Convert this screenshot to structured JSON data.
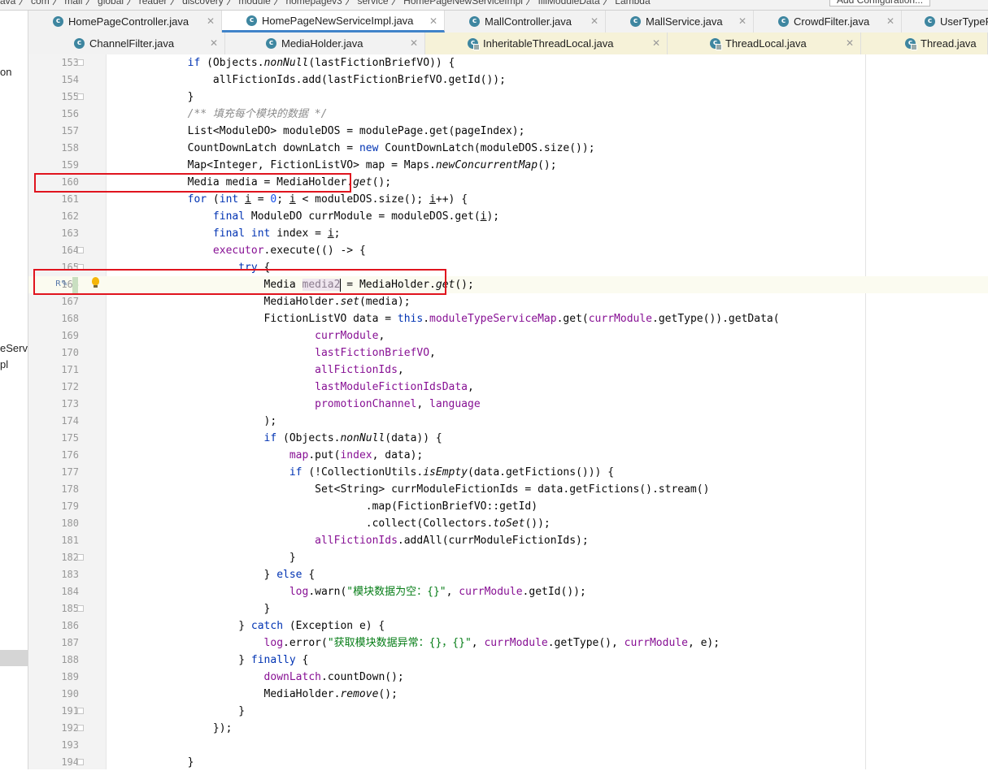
{
  "breadcrumb": {
    "path_text": "ava 〉 com 〉 mall 〉 global 〉 reader 〉 discovery 〉 module 〉 homepagev3 〉 service 〉 HomePageNewServiceImpl 〉 fillModuleData 〉 Lambda",
    "run_config": "Add Configuration..."
  },
  "left_panel": {
    "items": [
      "on",
      "eServi",
      "pl"
    ]
  },
  "tabs_row1": [
    {
      "label": "HomePageController.java"
    },
    {
      "label": "HomePageNewServiceImpl.java"
    },
    {
      "label": "MallController.java"
    },
    {
      "label": "MallService.java"
    },
    {
      "label": "CrowdFilter.java"
    },
    {
      "label": "UserTypeF"
    }
  ],
  "tabs_row2": [
    {
      "label": "ChannelFilter.java"
    },
    {
      "label": "MediaHolder.java"
    },
    {
      "label": "InheritableThreadLocal.java"
    },
    {
      "label": "ThreadLocal.java"
    },
    {
      "label": "Thread.java"
    }
  ],
  "editor": {
    "current_line": 166,
    "lines": [
      {
        "n": 153,
        "html": "        <span class=\"kw\">if</span> (Objects.<span class=\"it\">nonNull</span>(lastFictionBriefVO)) {"
      },
      {
        "n": 154,
        "html": "            allFictionIds.add(lastFictionBriefVO.getId());"
      },
      {
        "n": 155,
        "html": "        }"
      },
      {
        "n": 156,
        "html": "        <span class=\"cmt\">/** 填充每个模块的数据 */</span>"
      },
      {
        "n": 157,
        "html": "        List&lt;ModuleDO&gt; moduleDOS = modulePage.get(pageIndex);"
      },
      {
        "n": 158,
        "html": "        CountDownLatch downLatch = <span class=\"kw\">new</span> CountDownLatch(moduleDOS.size());"
      },
      {
        "n": 159,
        "html": "        Map&lt;Integer, FictionListVO&gt; map = Maps.<span class=\"it\">newConcurrentMap</span>();"
      },
      {
        "n": 160,
        "html": "        Media media = MediaHolder.<span class=\"it\">get</span>();"
      },
      {
        "n": 161,
        "html": "        <span class=\"kw\">for</span> (<span class=\"kw\">int</span> <span class=\"ul\">i</span> = <span class=\"num\">0</span>; <span class=\"ul\">i</span> &lt; moduleDOS.size(); <span class=\"ul\">i</span>++) {"
      },
      {
        "n": 162,
        "html": "            <span class=\"kw\">final</span> ModuleDO currModule = moduleDOS.get(<span class=\"ul\">i</span>);"
      },
      {
        "n": 163,
        "html": "            <span class=\"kw\">final int</span> index = <span class=\"ul\">i</span>;"
      },
      {
        "n": 164,
        "html": "            <span class=\"fld\">executor</span>.execute(() -&gt; {"
      },
      {
        "n": 165,
        "html": "                <span class=\"kw\">try</span> {"
      },
      {
        "n": 166,
        "html": "                    Media <span class=\"unused\">media2</span><span class=\"caret\"></span> = MediaHolder.<span class=\"it\">get</span>();"
      },
      {
        "n": 167,
        "html": "                    MediaHolder.<span class=\"it\">set</span>(media);"
      },
      {
        "n": 168,
        "html": "                    FictionListVO data = <span class=\"kw\">this</span>.<span class=\"fld\">moduleTypeServiceMap</span>.get(<span class=\"fld\">currModule</span>.getType()).getData("
      },
      {
        "n": 169,
        "html": "                            <span class=\"fld\">currModule</span>,"
      },
      {
        "n": 170,
        "html": "                            <span class=\"fld\">lastFictionBriefVO</span>,"
      },
      {
        "n": 171,
        "html": "                            <span class=\"fld\">allFictionIds</span>,"
      },
      {
        "n": 172,
        "html": "                            <span class=\"fld\">lastModuleFictionIdsData</span>,"
      },
      {
        "n": 173,
        "html": "                            <span class=\"fld\">promotionChannel</span>, <span class=\"fld\">language</span>"
      },
      {
        "n": 174,
        "html": "                    );"
      },
      {
        "n": 175,
        "html": "                    <span class=\"kw\">if</span> (Objects.<span class=\"it\">nonNull</span>(data)) {"
      },
      {
        "n": 176,
        "html": "                        <span class=\"fld\">map</span>.put(<span class=\"fld\">index</span>, data);"
      },
      {
        "n": 177,
        "html": "                        <span class=\"kw\">if</span> (!CollectionUtils.<span class=\"it\">isEmpty</span>(data.getFictions())) {"
      },
      {
        "n": 178,
        "html": "                            Set&lt;String&gt; currModuleFictionIds = data.getFictions().stream()"
      },
      {
        "n": 179,
        "html": "                                    .map(FictionBriefVO::getId)"
      },
      {
        "n": 180,
        "html": "                                    .collect(Collectors.<span class=\"it\">toSet</span>());"
      },
      {
        "n": 181,
        "html": "                            <span class=\"fld\">allFictionIds</span>.addAll(currModuleFictionIds);"
      },
      {
        "n": 182,
        "html": "                        }"
      },
      {
        "n": 183,
        "html": "                    } <span class=\"kw\">else</span> {"
      },
      {
        "n": 184,
        "html": "                        <span class=\"fld\">log</span>.warn(<span class=\"str\">\"模块数据为空：{}\"</span>, <span class=\"fld\">currModule</span>.getId());"
      },
      {
        "n": 185,
        "html": "                    }"
      },
      {
        "n": 186,
        "html": "                } <span class=\"kw\">catch</span> (Exception e) {"
      },
      {
        "n": 187,
        "html": "                    <span class=\"fld\">log</span>.error(<span class=\"str\">\"获取模块数据异常：{}，{}\"</span>, <span class=\"fld\">currModule</span>.getType(), <span class=\"fld\">currModule</span>, e);"
      },
      {
        "n": 188,
        "html": "                } <span class=\"kw\">finally</span> {"
      },
      {
        "n": 189,
        "html": "                    <span class=\"fld\">downLatch</span>.countDown();"
      },
      {
        "n": 190,
        "html": "                    MediaHolder.<span class=\"it\">remove</span>();"
      },
      {
        "n": 191,
        "html": "                }"
      },
      {
        "n": 192,
        "html": "            });"
      },
      {
        "n": 193,
        "html": ""
      },
      {
        "n": 194,
        "html": "        }"
      }
    ]
  }
}
